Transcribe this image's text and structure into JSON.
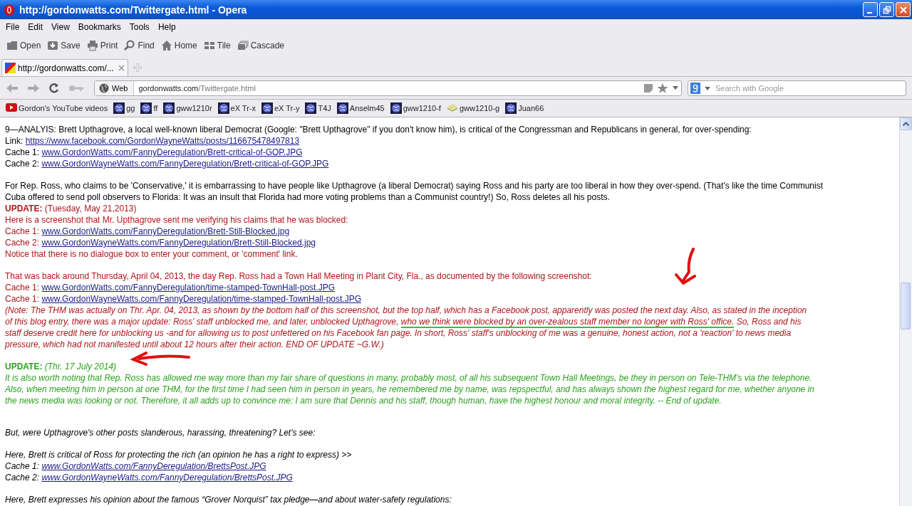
{
  "window": {
    "title": "http://gordonwatts.com/Twittergate.html - Opera"
  },
  "menu": [
    "File",
    "Edit",
    "View",
    "Bookmarks",
    "Tools",
    "Help"
  ],
  "toolbar": [
    {
      "label": "Open",
      "kind": "folder"
    },
    {
      "label": "Save",
      "kind": "save"
    },
    {
      "label": "Print",
      "kind": "print"
    },
    {
      "label": "Find",
      "kind": "find"
    },
    {
      "label": "Home",
      "kind": "home"
    },
    {
      "label": "Tile",
      "kind": "tile"
    },
    {
      "label": "Cascade",
      "kind": "cascade"
    }
  ],
  "tabs": [
    {
      "label": "http://gordonwatts.com/...",
      "selected": true
    }
  ],
  "address": {
    "mode": "Web",
    "host": "gordonwatts.com",
    "path": "/Twittergate.html"
  },
  "search": {
    "placeholder": "Search with Google"
  },
  "bookmarks": [
    {
      "label": "Gordon's YouTube videos",
      "kind": "video"
    },
    {
      "label": "gg",
      "kind": "globe"
    },
    {
      "label": "ff",
      "kind": "globe"
    },
    {
      "label": "gww1210r",
      "kind": "globe"
    },
    {
      "label": "eX Tr-x",
      "kind": "globe"
    },
    {
      "label": "eX Tr-y",
      "kind": "globe"
    },
    {
      "label": "T4J",
      "kind": "globe"
    },
    {
      "label": "Anselm45",
      "kind": "globe"
    },
    {
      "label": "gww1210-f",
      "kind": "globe"
    },
    {
      "label": "gww1210-g",
      "kind": "envelope"
    },
    {
      "label": "Juan66",
      "kind": "globe"
    }
  ],
  "sections": [
    {
      "parts": [
        {
          "color": "#000000",
          "italic": false,
          "lines": [
            {
              "text": "9—ANALYIS: Brett Upthagrove, a local well-known liberal Democrat (Google: \"Brett Upthagrove\" if you don't know him), is critical of the Congressman and Republicans in general, for over-spending:"
            },
            {
              "text": "Link: ",
              "link": "https://www.facebook.com/GordonWayneWatts/posts/116675478497813"
            },
            {
              "text": "Cache 1: ",
              "link": "www.GordonWatts.com/FannyDeregulation/Brett-critical-of-GOP.JPG"
            },
            {
              "text": "Cache 2: ",
              "link": "www.GordonWayneWatts.com/FannyDeregulation/Brett-critical-of-GOP.JPG"
            }
          ]
        }
      ]
    },
    {
      "parts": [
        {
          "color": "#000000",
          "italic": false,
          "lines": [
            {
              "text": "For Rep. Ross, who claims to be 'Conservative,' it is embarrassing to have people like Upthagrove (a liberal Democrat) saying Ross and his party are too liberal in how they over-spend. (That's like the time Communist"
            },
            {
              "text": "Cuba offered to send poll observers to Florida: It was an insult that Florida had more voting problems than a Communist country!) So, Ross deletes all his posts."
            }
          ]
        },
        {
          "color": "#b0141a",
          "italic": false,
          "lines": [
            {
              "text": "**UPDATE:** (Tuesday, May 21,2013)"
            },
            {
              "text": "Here is a screenshot that Mr. Upthagrove sent me verifying his claims that he was blocked:"
            },
            {
              "text": "Cache 1: ",
              "link": "www.GordonWatts.com/FannyDeregulation/Brett-Still-Blocked.jpg"
            },
            {
              "text": "Cache 2: ",
              "link": "www.GordonWayneWatts.com/FannyDeregulation/Brett-Still-Blocked.jpg"
            },
            {
              "text": "Notice that there is no dialogue box to enter your comment, or 'comment' link."
            }
          ]
        }
      ]
    },
    {
      "annotation": {
        "kind": "down-arrow"
      },
      "parts": [
        {
          "color": "#b0141a",
          "italic": false,
          "lines": [
            {
              "text": "That was back around Thursday, April 04, 2013, the day Rep. Ross had a Town Hall Meeting in Plant City, Fla., as documented by the following screenshot:"
            },
            {
              "text": "Cache 1: ",
              "link": "www.GordonWatts.com/FannyDeregulation/time-stamped-TownHall-post.JPG"
            },
            {
              "text": "Cache 1: ",
              "link": "www.GordonWayneWatts.com/FannyDeregulation/time-stamped-TownHall-post.JPG"
            }
          ]
        },
        {
          "color": "#b0141a",
          "italic": true,
          "lines": [
            {
              "text": "(Note: The THM was actually on Thr. Apr. 04, 2013, as shown by the bottom half of this screenshot, but the top half, which has a Facebook post, apparently was posted the next day. Also, as stated in the inception"
            },
            {
              "text": "of this blog entry, there was a major update: Ross' staff unblocked me, and later, unblocked Upthagrove, ",
              "marked": "who we think were blocked by an over-zealous staff member no longer with Ross' office.",
              "after": " So, Ross and his"
            },
            {
              "text": "staff deserve credit here for unblocking us -and for allowing us to post unfettered on his Facebook fan page. In short, Ross' staff's unblocking of me was a genuine, honest action, not a 'reaction' to news media"
            },
            {
              "text": "pressure, which had not manifested until about 12 hours *after* their action. END OF UPDATE ~G.W.)"
            }
          ]
        }
      ]
    },
    {
      "annotation": {
        "kind": "left-arrow"
      },
      "parts": [
        {
          "color": "#2aa31c",
          "italic": false,
          "lines": [
            {
              "text": "**UPDATE:** *(Thr. 17 July 2014)*"
            }
          ]
        },
        {
          "color": "#2aa31c",
          "italic": true,
          "lines": [
            {
              "text": "It is also worth noting that Rep. Ross has allowed me way more than my fair share of questions in many, probably most, of all his subsequent Town Hall Meetings, be they in person on Tele-THM's via the telephone."
            },
            {
              "text": "Also, when meeting him in person at one THM, for the first time I had seen him in person in years, he remembered me by name, was repspectful, and has always shown the highest regard for me, whether anyone in"
            },
            {
              "text": "the news media was looking or not. Therefore, it all adds up to convince me: I am sure that Dennis and his staff, though human, have the highest honour and moral integrity. -- End of update."
            }
          ]
        }
      ]
    },
    {
      "parts": [
        {
          "color": "#000000",
          "italic": true,
          "lines": [
            {
              "text": "But, were Upthagrove's other posts slanderous, harassing, threatening? Let's see:"
            }
          ]
        }
      ]
    },
    {
      "parts": [
        {
          "color": "#000000",
          "italic": true,
          "lines": [
            {
              "text": "Here, Brett is critical of Ross for protecting the rich (an opinion he has a right to express) >>"
            },
            {
              "text": "Cache 1: ",
              "link": "www.GordonWatts.com/FannyDeregulation/BrettsPost.JPG"
            },
            {
              "text": "Cache 2: ",
              "link": "www.GordonWayneWatts.com/FannyDeregulation/BrettsPost.JPG"
            }
          ]
        }
      ]
    },
    {
      "parts": [
        {
          "color": "#000000",
          "italic": true,
          "lines": [
            {
              "text": "Here, Brett expresses his opinion about the famous “Grover Norquist” tax pledge—and about water-safety regulations:"
            }
          ]
        }
      ]
    }
  ]
}
